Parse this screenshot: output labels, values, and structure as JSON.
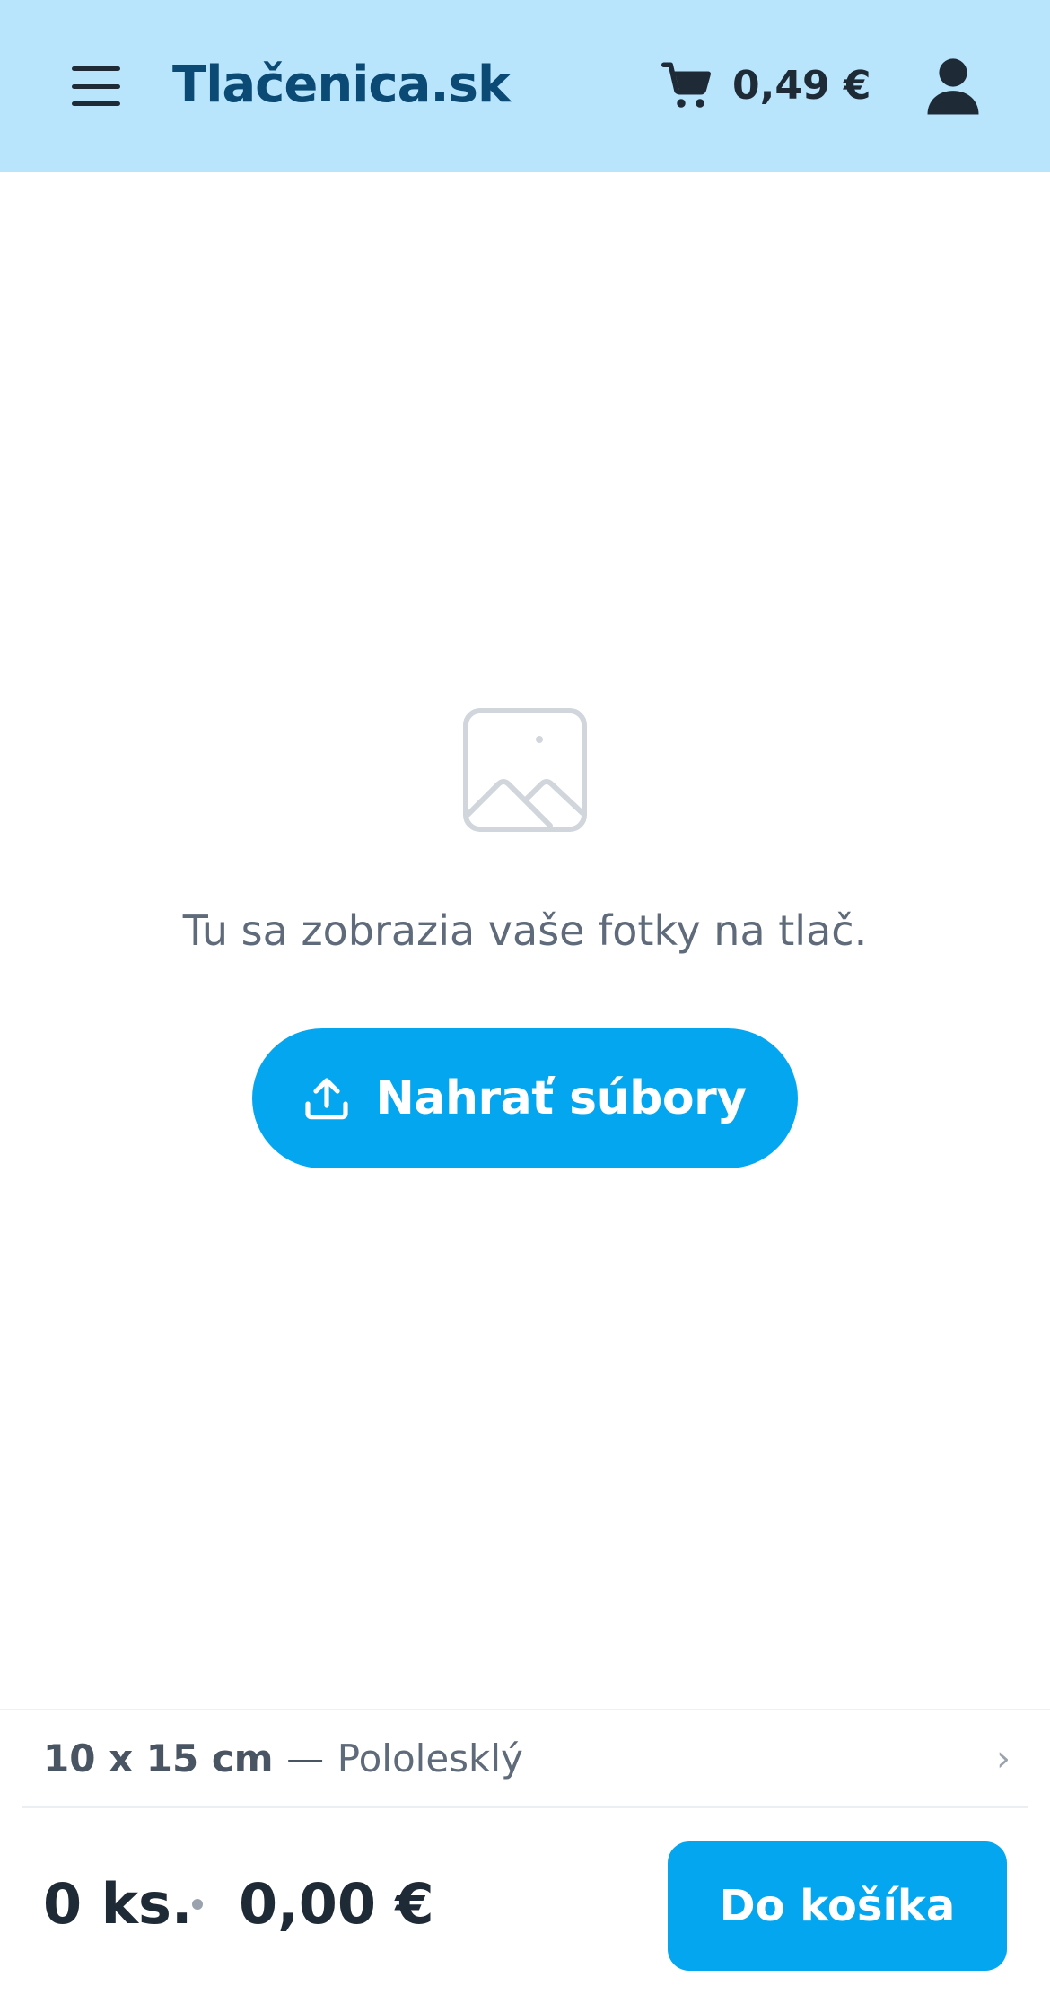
{
  "header": {
    "brand": "Tlačenica.sk",
    "cart_total": "0,49 €",
    "menu_icon": "hamburger-menu-icon",
    "cart_icon": "shopping-cart-icon",
    "user_icon": "user-icon"
  },
  "empty_state": {
    "icon": "image-placeholder-icon",
    "message": "Tu sa zobrazia vaše fotky na tlač.",
    "upload_label": "Nahrať súbory",
    "upload_icon": "upload-icon"
  },
  "bottom_panel": {
    "format_size": "10 x 15 cm",
    "format_separator": "—",
    "format_finish": "Pololesklý",
    "chevron": "›",
    "quantity": "0 ks.",
    "price": "0,00 €",
    "add_to_cart_label": "Do košíka"
  },
  "colors": {
    "header_bg": "#b8e5fc",
    "brand": "#0a4a75",
    "accent": "#05a6f0",
    "text_dark": "#1f2a37",
    "text_muted": "#5f6b7a"
  }
}
